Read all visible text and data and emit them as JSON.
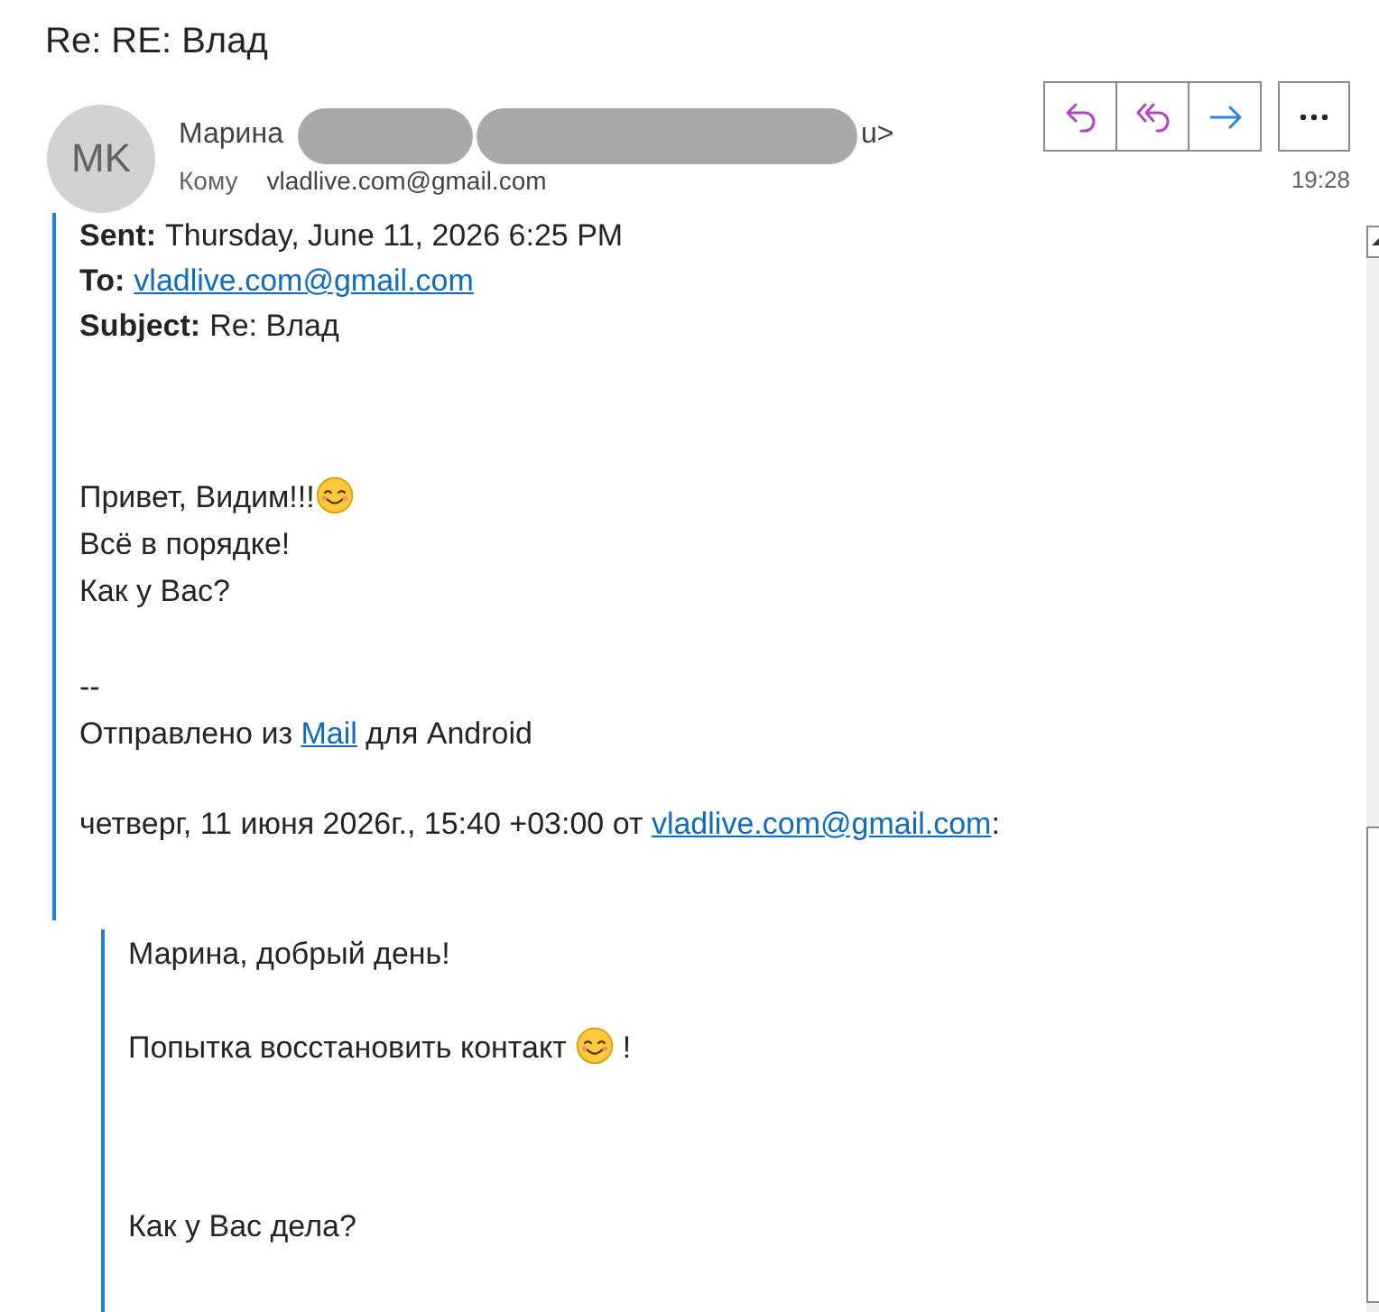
{
  "title": "Re: RE: Влад",
  "message": {
    "avatar_initials": "MK",
    "sender": {
      "name": "Марина",
      "redacted": true,
      "address_end": "u>"
    },
    "to_label": "Кому",
    "to_address": "vladlive.com@gmail.com",
    "time": "19:28",
    "actions": [
      {
        "kind": "reply"
      },
      {
        "kind": "reply_all"
      },
      {
        "kind": "forward"
      },
      {
        "kind": "more"
      }
    ]
  },
  "body": {
    "headers": [
      {
        "label": "Sent:",
        "kind": "text",
        "value": "Thursday, June 11, 2026 6:25 PM"
      },
      {
        "label": "To:",
        "kind": "link",
        "value": "vladlive.com@gmail.com"
      },
      {
        "label": "Subject:",
        "kind": "text",
        "value": "Re: Влад"
      }
    ],
    "paragraphs": [
      {
        "lines": [
          {
            "segments": [
              {
                "kind": "text",
                "text": "Привет, Видим!!!"
              },
              {
                "kind": "emoji"
              }
            ]
          },
          {
            "segments": [
              {
                "kind": "text",
                "text": "Всё в порядке!"
              }
            ]
          },
          {
            "segments": [
              {
                "kind": "text",
                "text": "Как у Вас?"
              }
            ]
          }
        ]
      },
      {
        "lines": [
          {
            "segments": [
              {
                "kind": "text",
                "text": "--"
              }
            ]
          },
          {
            "segments": [
              {
                "kind": "text",
                "text": "Отправлено из "
              },
              {
                "kind": "link",
                "text": "Mail"
              },
              {
                "kind": "text",
                "text": " для Android"
              }
            ]
          }
        ]
      },
      {
        "lines": [
          {
            "segments": [
              {
                "kind": "text",
                "text": "четверг, 11 июня 2026г., 15:40 +03:00 от "
              },
              {
                "kind": "link",
                "text": "vladlive.com@gmail.com"
              },
              {
                "kind": "text",
                "text": ":"
              }
            ]
          }
        ]
      }
    ],
    "quote": {
      "paragraphs": [
        {
          "lines": [
            {
              "segments": [
                {
                  "kind": "text",
                  "text": "Марина, добрый день!"
                }
              ]
            }
          ]
        },
        {
          "lines": [
            {
              "segments": [
                {
                  "kind": "text",
                  "text": "Попытка восстановить контакт"
                },
                {
                  "kind": "emoji"
                },
                {
                  "kind": "text",
                  "text": "!"
                }
              ]
            }
          ]
        },
        {
          "lines": [
            {
              "segments": [
                {
                  "kind": "text",
                  "text": "Как у Вас дела?"
                }
              ]
            }
          ]
        }
      ]
    }
  }
}
